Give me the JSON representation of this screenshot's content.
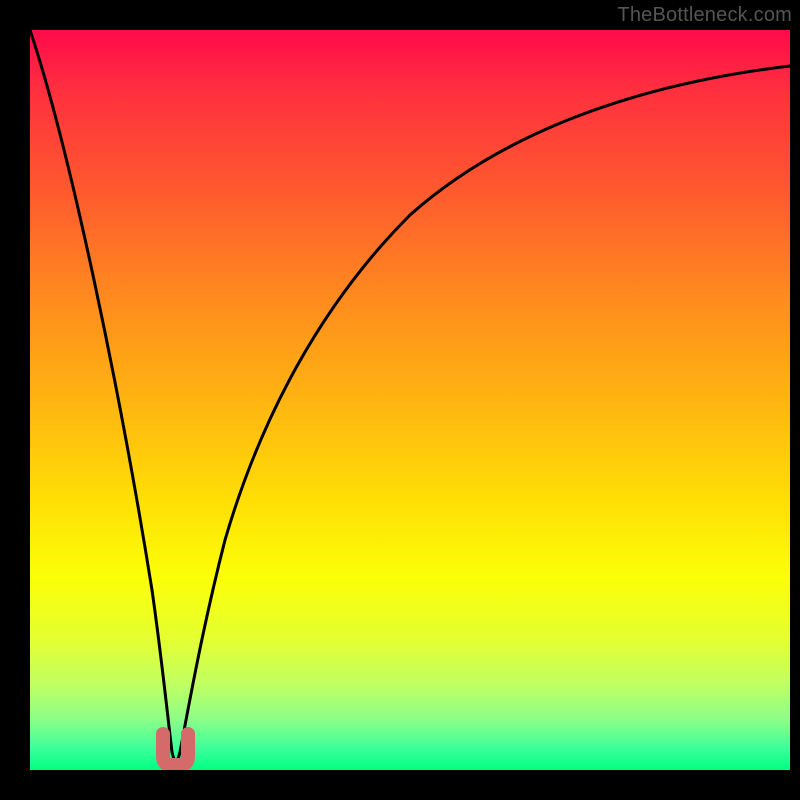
{
  "watermark": "TheBottleneck.com",
  "chart_data": {
    "type": "line",
    "title": "",
    "xlabel": "",
    "ylabel": "",
    "xlim": [
      0,
      100
    ],
    "ylim": [
      0,
      100
    ],
    "series": [
      {
        "name": "bottleneck-curve",
        "x": [
          0,
          2,
          5,
          8,
          11,
          14,
          16,
          17,
          17.8,
          18.5,
          19.2,
          20,
          21,
          22,
          24,
          27,
          31,
          36,
          42,
          50,
          60,
          72,
          85,
          100
        ],
        "y": [
          100,
          88,
          71,
          54,
          38,
          22,
          11,
          6,
          2.5,
          1,
          1,
          2.5,
          6,
          11,
          22,
          36,
          50,
          62,
          72,
          80,
          86,
          90.5,
          93.5,
          95
        ]
      },
      {
        "name": "highlight-range",
        "x": [
          17.3,
          19.7
        ],
        "y": [
          0,
          0
        ],
        "note": "pink U-shaped marker at curve trough"
      }
    ],
    "gradient_stops": [
      {
        "pos": 0,
        "color": "#ff0a4a"
      },
      {
        "pos": 50,
        "color": "#ffb411"
      },
      {
        "pos": 74,
        "color": "#fbff07"
      },
      {
        "pos": 100,
        "color": "#00ff82"
      }
    ]
  }
}
